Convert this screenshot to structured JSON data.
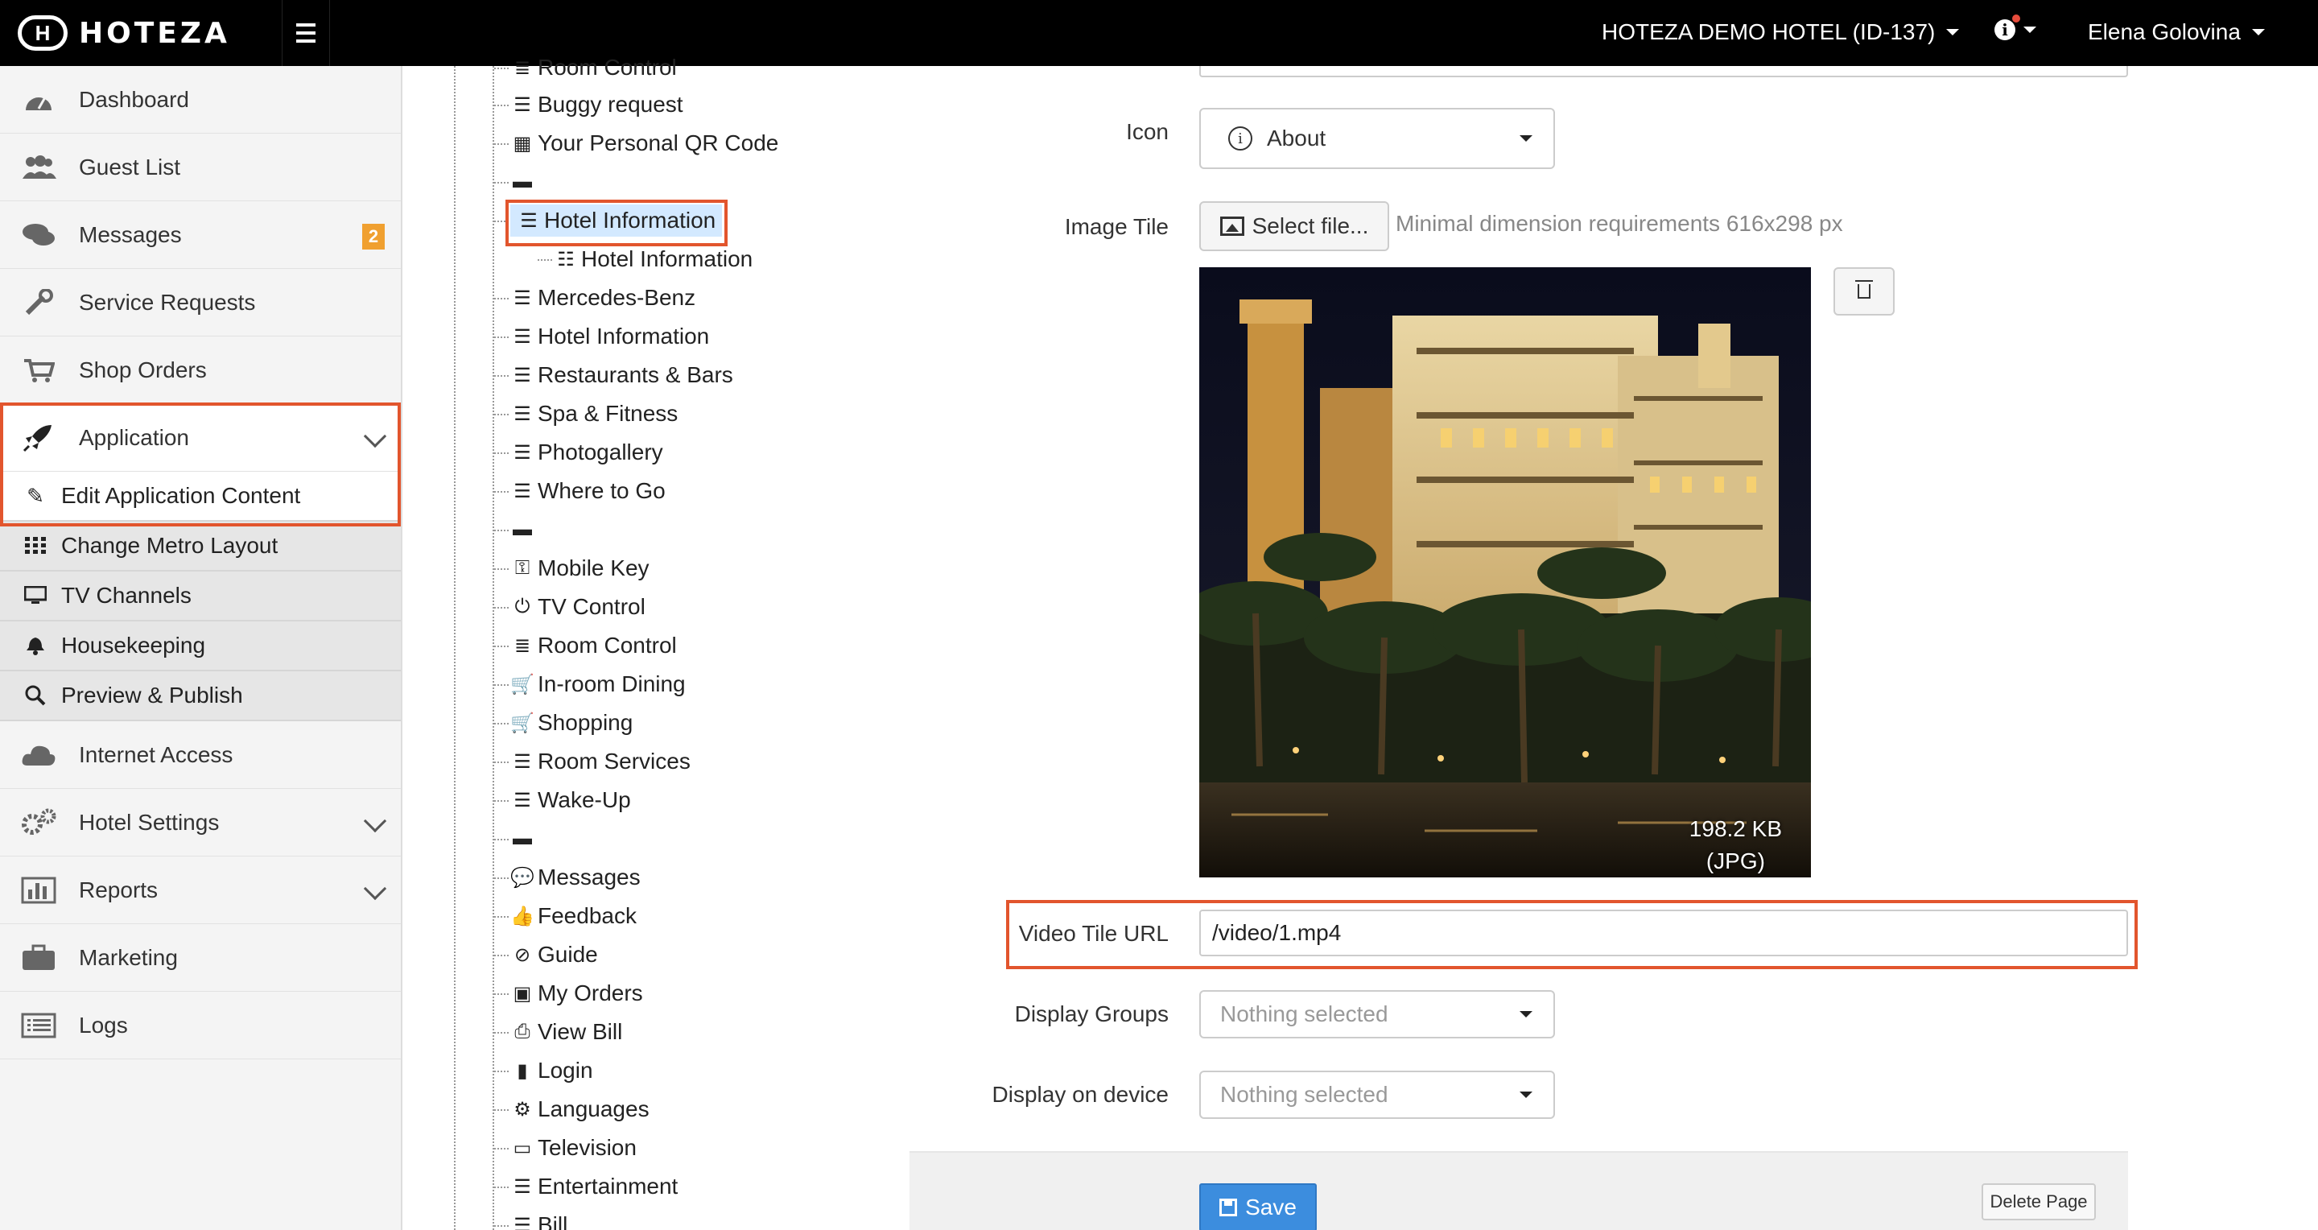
{
  "header": {
    "logo_text": "HOTEZA",
    "hotel": "HOTEZA DEMO HOTEL (ID-137)",
    "user": "Elena Golovina"
  },
  "sidebar": {
    "items": [
      {
        "label": "Dashboard",
        "icon": "dashboard-icon"
      },
      {
        "label": "Guest List",
        "icon": "users-icon"
      },
      {
        "label": "Messages",
        "icon": "comments-icon",
        "badge": "2"
      },
      {
        "label": "Service Requests",
        "icon": "wrench-icon"
      },
      {
        "label": "Shop Orders",
        "icon": "cart-icon"
      },
      {
        "label": "Application",
        "icon": "rocket-icon"
      }
    ],
    "sub_items": [
      {
        "label": "Edit Application Content",
        "icon": "edit-icon"
      },
      {
        "label": "Change Metro Layout",
        "icon": "grid-icon"
      },
      {
        "label": "TV Channels",
        "icon": "monitor-icon"
      },
      {
        "label": "Housekeeping",
        "icon": "bell-icon"
      },
      {
        "label": "Preview & Publish",
        "icon": "zoom-icon"
      }
    ],
    "items_after": [
      {
        "label": "Internet Access",
        "icon": "cloud-icon"
      },
      {
        "label": "Hotel Settings",
        "icon": "cogs-icon"
      },
      {
        "label": "Reports",
        "icon": "bar-chart-icon"
      },
      {
        "label": "Marketing",
        "icon": "briefcase-icon"
      },
      {
        "label": "Logs",
        "icon": "list-icon"
      }
    ]
  },
  "tree": {
    "nodes": [
      {
        "label": "Room Control",
        "icon": "≣"
      },
      {
        "label": "Buggy request",
        "icon": "☰"
      },
      {
        "label": "Your Personal QR Code",
        "icon": "▦"
      },
      {
        "label": "",
        "icon": "▬"
      },
      {
        "label": "Hotel Information",
        "icon": "☰"
      },
      {
        "label": "Hotel Information",
        "icon": "☷"
      },
      {
        "label": "Mercedes-Benz",
        "icon": "☰"
      },
      {
        "label": "Hotel Information",
        "icon": "☰"
      },
      {
        "label": "Restaurants & Bars",
        "icon": "☰"
      },
      {
        "label": "Spa & Fitness",
        "icon": "☰"
      },
      {
        "label": "Photogallery",
        "icon": "☰"
      },
      {
        "label": "Where to Go",
        "icon": "☰"
      },
      {
        "label": "",
        "icon": "▬"
      },
      {
        "label": "Mobile Key",
        "icon": "⚿"
      },
      {
        "label": "TV Control",
        "icon": "⏻"
      },
      {
        "label": "Room Control",
        "icon": "≣"
      },
      {
        "label": "In-room Dining",
        "icon": "🛒"
      },
      {
        "label": "Shopping",
        "icon": "🛒"
      },
      {
        "label": "Room Services",
        "icon": "☰"
      },
      {
        "label": "Wake-Up",
        "icon": "☰"
      },
      {
        "label": "",
        "icon": "▬"
      },
      {
        "label": "Messages",
        "icon": "💬"
      },
      {
        "label": "Feedback",
        "icon": "👍"
      },
      {
        "label": "Guide",
        "icon": "⊘"
      },
      {
        "label": "My Orders",
        "icon": "▣"
      },
      {
        "label": "View Bill",
        "icon": "⎙"
      },
      {
        "label": "Login",
        "icon": "▮"
      },
      {
        "label": "Languages",
        "icon": "⚙"
      },
      {
        "label": "Television",
        "icon": "▭"
      },
      {
        "label": "Entertainment",
        "icon": "☰"
      },
      {
        "label": "Bill",
        "icon": "☰"
      }
    ]
  },
  "form": {
    "icon_label": "Icon",
    "icon_value": "About",
    "image_tile_label": "Image Tile",
    "select_file": "Select file...",
    "hint": "Minimal dimension requirements 616x298 px",
    "image_size": "198.2 KB",
    "image_type": "(JPG)",
    "video_label": "Video Tile URL",
    "video_value": "/video/1.mp4",
    "groups_label": "Display Groups",
    "groups_value": "Nothing selected",
    "device_label": "Display on device",
    "device_value": "Nothing selected",
    "save": "Save",
    "delete": "Delete Page"
  },
  "colors": {
    "highlight": "#e2552d",
    "primary": "#3c8dde",
    "badge": "#f0a030",
    "selected_node": "#d3e9ff"
  }
}
